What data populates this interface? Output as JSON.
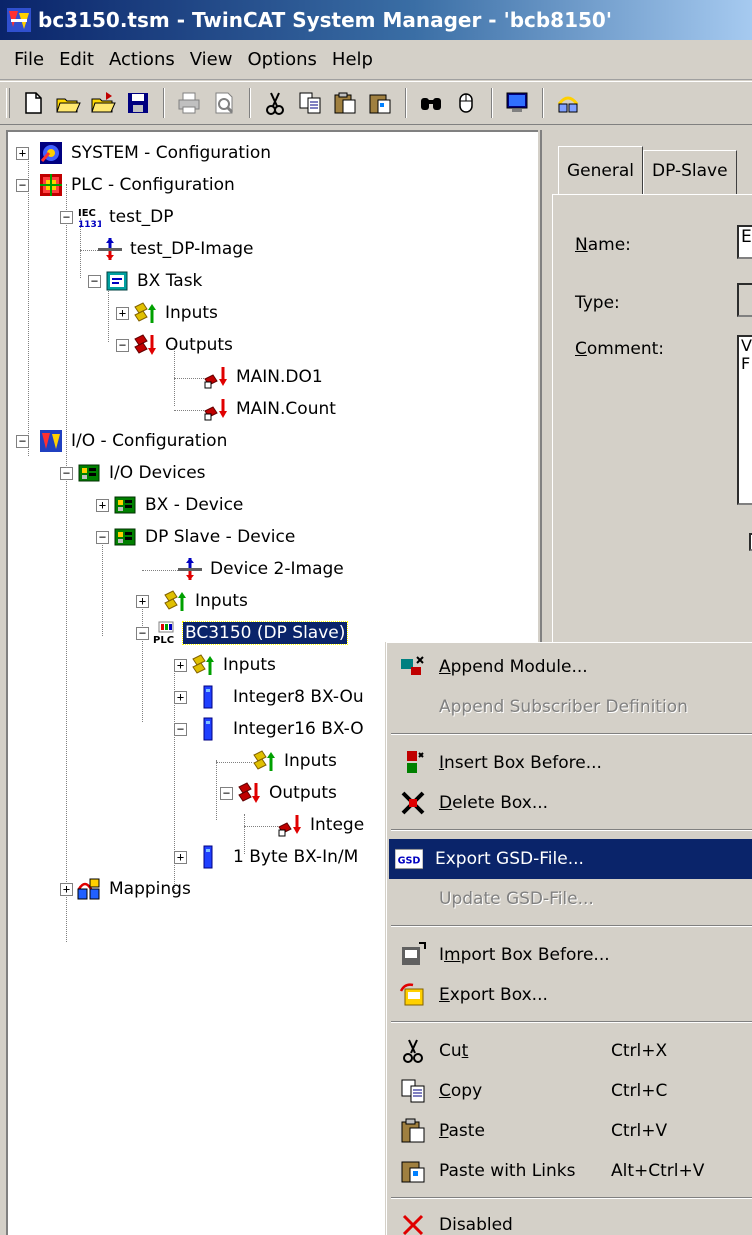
{
  "window": {
    "title": "bc3150.tsm - TwinCAT System Manager - 'bcb8150'"
  },
  "menubar": [
    "File",
    "Edit",
    "Actions",
    "View",
    "Options",
    "Help"
  ],
  "toolbar": [
    "new-icon",
    "open-icon",
    "open-folder-icon",
    "save-icon",
    "print-icon",
    "print-preview-icon",
    "cut-icon",
    "copy-icon",
    "paste-icon",
    "paste-links-icon",
    "find-icon",
    "mouse-icon",
    "monitor-icon",
    "network-icon"
  ],
  "tree": [
    {
      "label": "SYSTEM - Configuration",
      "icon": "system-icon"
    },
    {
      "label": "PLC - Configuration",
      "icon": "plc-config-icon"
    },
    {
      "label": "test_DP",
      "icon": "iec-icon",
      "badge": "IEC 1131"
    },
    {
      "label": "test_DP-Image",
      "icon": "image-icon"
    },
    {
      "label": "BX Task",
      "icon": "task-icon"
    },
    {
      "label": "Inputs",
      "icon": "inputs-icon"
    },
    {
      "label": "Outputs",
      "icon": "outputs-icon"
    },
    {
      "label": "MAIN.DO1",
      "icon": "variable-out-icon"
    },
    {
      "label": "MAIN.Count",
      "icon": "variable-out-icon"
    },
    {
      "label": "I/O - Configuration",
      "icon": "io-config-icon"
    },
    {
      "label": "I/O Devices",
      "icon": "device-icon"
    },
    {
      "label": "BX - Device",
      "icon": "device-icon"
    },
    {
      "label": "DP Slave - Device",
      "icon": "device-icon"
    },
    {
      "label": "Device 2-Image",
      "icon": "image-icon"
    },
    {
      "label": "Inputs",
      "icon": "inputs-icon"
    },
    {
      "label": "BC3150 (DP Slave)",
      "icon": "plc-box-icon",
      "badge": "PLC",
      "selected": true
    },
    {
      "label": "Inputs",
      "icon": "inputs-icon"
    },
    {
      "label": "Integer8 BX-Ou",
      "icon": "module-icon"
    },
    {
      "label": "Integer16 BX-O",
      "icon": "module-icon"
    },
    {
      "label": "Inputs",
      "icon": "inputs-icon"
    },
    {
      "label": "Outputs",
      "icon": "outputs-icon"
    },
    {
      "label": "Intege",
      "icon": "variable-out-icon"
    },
    {
      "label": "1 Byte BX-In/M",
      "icon": "module-icon"
    },
    {
      "label": "Mappings",
      "icon": "mappings-icon"
    }
  ],
  "rightpanel": {
    "tabs": [
      "General",
      "DP-Slave"
    ],
    "fields": {
      "name": "Name:",
      "type": "Type:",
      "comment": "Comment:"
    },
    "comment_fragment": [
      "V",
      "F"
    ],
    "name_fragment": "E"
  },
  "contextmenu": {
    "items": [
      {
        "label": "Append Module...",
        "icon": "append-module-icon"
      },
      {
        "label": "Append Subscriber Definition",
        "disabled": true
      },
      {
        "label": "Insert Box Before...",
        "icon": "insert-box-icon"
      },
      {
        "label": "Delete Box...",
        "icon": "delete-box-icon"
      },
      {
        "label": "Export GSD-File...",
        "icon": "gsd-icon",
        "badge": "GSD",
        "highlight": true
      },
      {
        "label": "Update GSD-File...",
        "disabled": true
      },
      {
        "label": "Import Box Before...",
        "icon": "import-box-icon"
      },
      {
        "label": "Export Box...",
        "icon": "export-box-icon"
      },
      {
        "label": "Cut",
        "shortcut": "Ctrl+X",
        "icon": "cut-icon"
      },
      {
        "label": "Copy",
        "shortcut": "Ctrl+C",
        "icon": "copy-icon"
      },
      {
        "label": "Paste",
        "shortcut": "Ctrl+V",
        "icon": "paste-icon"
      },
      {
        "label": "Paste with Links",
        "shortcut": "Alt+Ctrl+V",
        "icon": "paste-links-icon"
      },
      {
        "label": "Disabled",
        "icon": "disabled-icon"
      }
    ]
  },
  "colors": {
    "titlebar_start": "#0a246a",
    "selection": "#0a246a",
    "face": "#d4d0c8"
  }
}
